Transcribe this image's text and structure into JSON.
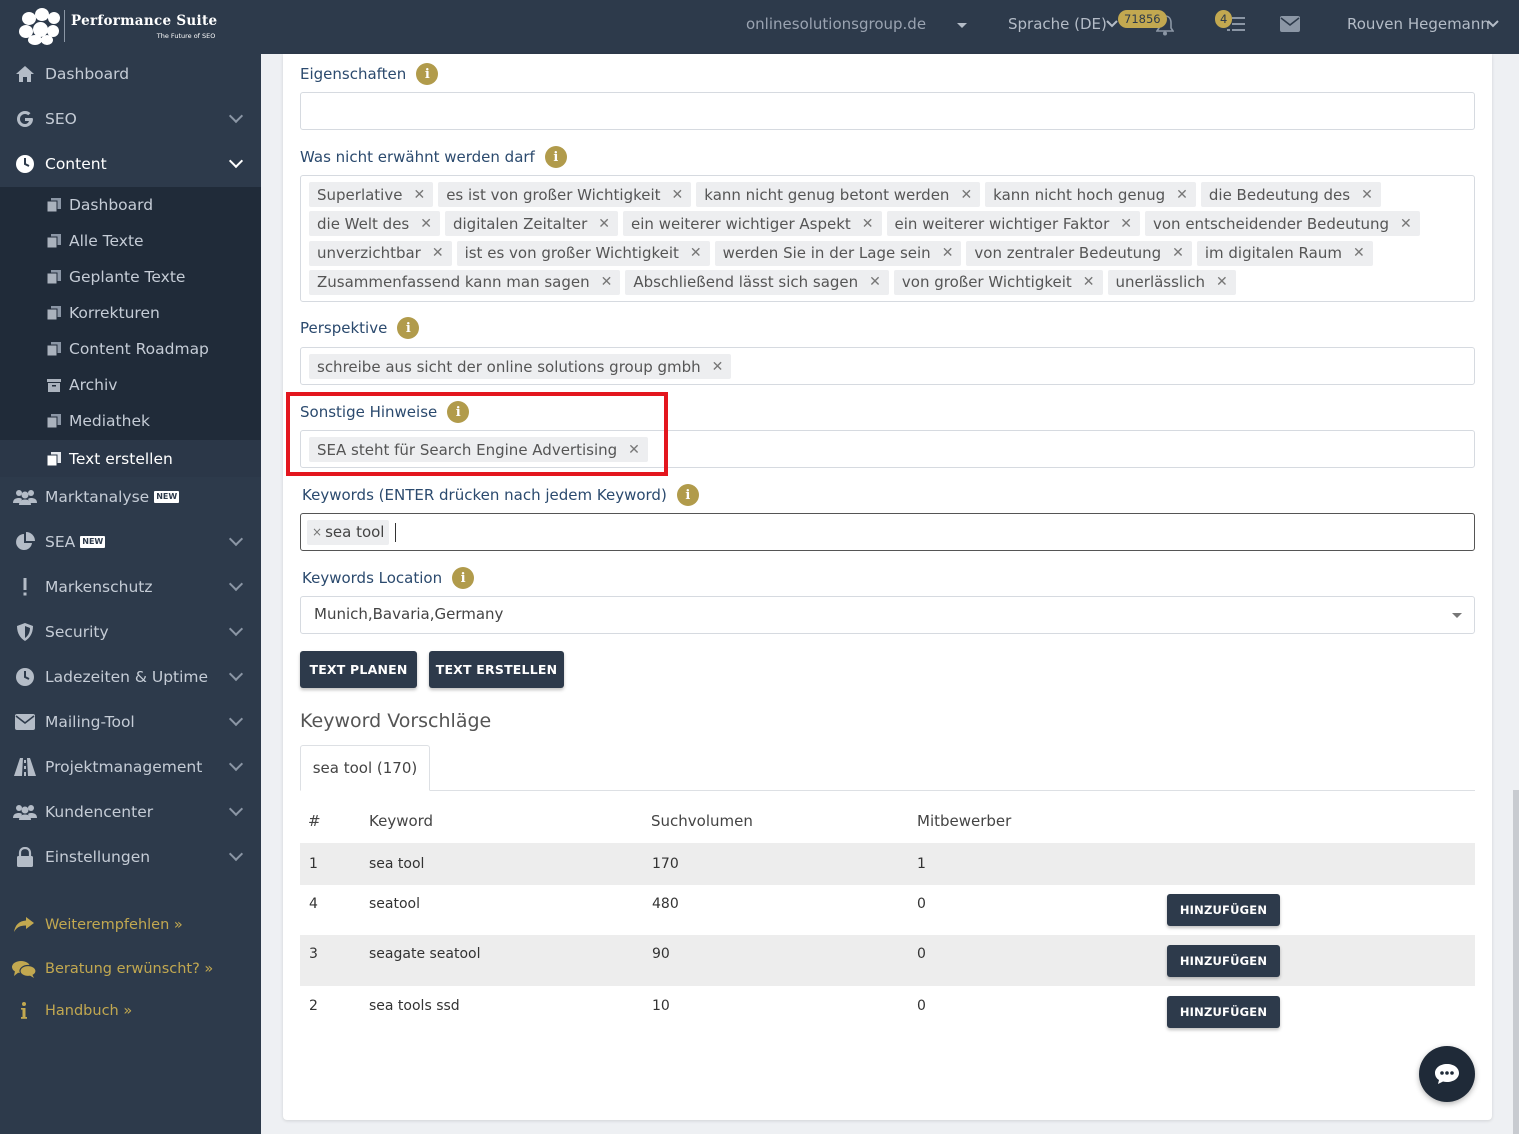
{
  "header": {
    "logo_title": "Performance Suite",
    "logo_subtitle": "The Future of SEO",
    "domain": "onlinesolutionsgroup.de",
    "language": "Sprache (DE)",
    "notifications_count": "71856",
    "tasks_count": "4",
    "user_name": "Rouven Hegemann"
  },
  "sidebar": {
    "items": [
      {
        "label": "Dashboard",
        "icon": "home-icon"
      },
      {
        "label": "SEO",
        "icon": "google-icon"
      },
      {
        "label": "Content",
        "icon": "clock-icon"
      },
      {
        "label": "Marktanalyse",
        "icon": "users-icon",
        "badge": "NEW"
      },
      {
        "label": "SEA",
        "icon": "pie-chart-icon",
        "badge": "NEW"
      },
      {
        "label": "Markenschutz",
        "icon": "exclamation-icon"
      },
      {
        "label": "Security",
        "icon": "shield-icon"
      },
      {
        "label": "Ladezeiten & Uptime",
        "icon": "clock-icon"
      },
      {
        "label": "Mailing-Tool",
        "icon": "envelope-icon"
      },
      {
        "label": "Projektmanagement",
        "icon": "road-icon"
      },
      {
        "label": "Kundencenter",
        "icon": "users-icon"
      },
      {
        "label": "Einstellungen",
        "icon": "lock-icon"
      }
    ],
    "content_submenu": [
      {
        "label": "Dashboard"
      },
      {
        "label": "Alle Texte"
      },
      {
        "label": "Geplante Texte"
      },
      {
        "label": "Korrekturen"
      },
      {
        "label": "Content Roadmap"
      },
      {
        "label": "Archiv"
      },
      {
        "label": "Mediathek"
      },
      {
        "label": "Text erstellen"
      }
    ],
    "bottom_links": [
      {
        "label": "Weiterempfehlen »",
        "icon": "share-icon"
      },
      {
        "label": "Beratung erwünscht? »",
        "icon": "comments-icon"
      },
      {
        "label": "Handbuch »",
        "icon": "info-icon"
      }
    ]
  },
  "form": {
    "eigenschaften": {
      "label": "Eigenschaften",
      "value": ""
    },
    "was_nicht": {
      "label": "Was nicht erwähnt werden darf",
      "tags": [
        "Superlative",
        "es ist von großer Wichtigkeit",
        "kann nicht genug betont werden",
        "kann nicht hoch genug",
        "die Bedeutung des",
        "die Welt des",
        "digitalen Zeitalter",
        "ein weiterer wichtiger Aspekt",
        "ein weiterer wichtiger Faktor",
        "von entscheidender Bedeutung",
        "unverzichtbar",
        "ist es von großer Wichtigkeit",
        "werden Sie in der Lage sein",
        "von zentraler Bedeutung",
        "im digitalen Raum",
        "Zusammenfassend kann man sagen",
        "Abschließend lässt sich sagen",
        "von großer Wichtigkeit",
        "unerlässlich"
      ]
    },
    "perspektive": {
      "label": "Perspektive",
      "tags": [
        "schreibe aus sicht der online solutions group gmbh"
      ]
    },
    "sonstige": {
      "label": "Sonstige Hinweise",
      "tags": [
        "SEA steht für Search Engine Advertising"
      ]
    },
    "keywords": {
      "label": "Keywords (ENTER drücken nach jedem Keyword)",
      "tags": [
        "sea tool"
      ]
    },
    "location": {
      "label": "Keywords Location",
      "value": "Munich,Bavaria,Germany"
    },
    "btn_plan": "TEXT PLANEN",
    "btn_create": "TEXT ERSTELLEN"
  },
  "suggestions": {
    "title": "Keyword Vorschläge",
    "tab": "sea tool (170)",
    "columns": [
      "#",
      "Keyword",
      "Suchvolumen",
      "Mitbewerber"
    ],
    "add_label": "HINZUFÜGEN",
    "rows": [
      {
        "num": "1",
        "keyword": "sea tool",
        "volume": "170",
        "competitors": "1",
        "addable": false
      },
      {
        "num": "4",
        "keyword": "seatool",
        "volume": "480",
        "competitors": "0",
        "addable": true
      },
      {
        "num": "3",
        "keyword": "seagate seatool",
        "volume": "90",
        "competitors": "0",
        "addable": true
      },
      {
        "num": "2",
        "keyword": "sea tools ssd",
        "volume": "10",
        "competitors": "0",
        "addable": true
      }
    ]
  }
}
